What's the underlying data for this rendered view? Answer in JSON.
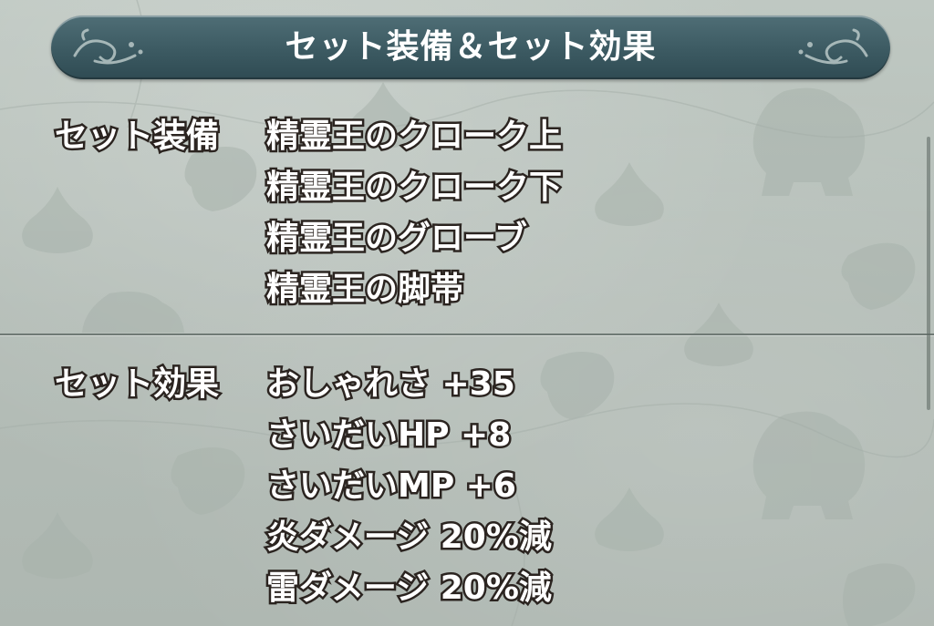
{
  "header": {
    "title": "セット装備＆セット効果"
  },
  "set_equipment": {
    "label": "セット装備",
    "items": [
      "精霊王のクローク上",
      "精霊王のクローク下",
      "精霊王のグローブ",
      "精霊王の脚帯"
    ]
  },
  "set_effects": {
    "label": "セット効果",
    "items": [
      "おしゃれさ  +35",
      "さいだいHP  +8",
      "さいだいMP  +6",
      "炎ダメージ  20%減",
      "雷ダメージ  20%減"
    ]
  },
  "colors": {
    "header_bar": "#3c5a62",
    "background": "#b9c2bc",
    "text": "#ffffff",
    "text_outline": "#2b2420"
  },
  "decor_icons": [
    "slime-silhouette-icon",
    "golem-silhouette-icon",
    "leaf-silhouette-icon",
    "flourish-icon"
  ]
}
